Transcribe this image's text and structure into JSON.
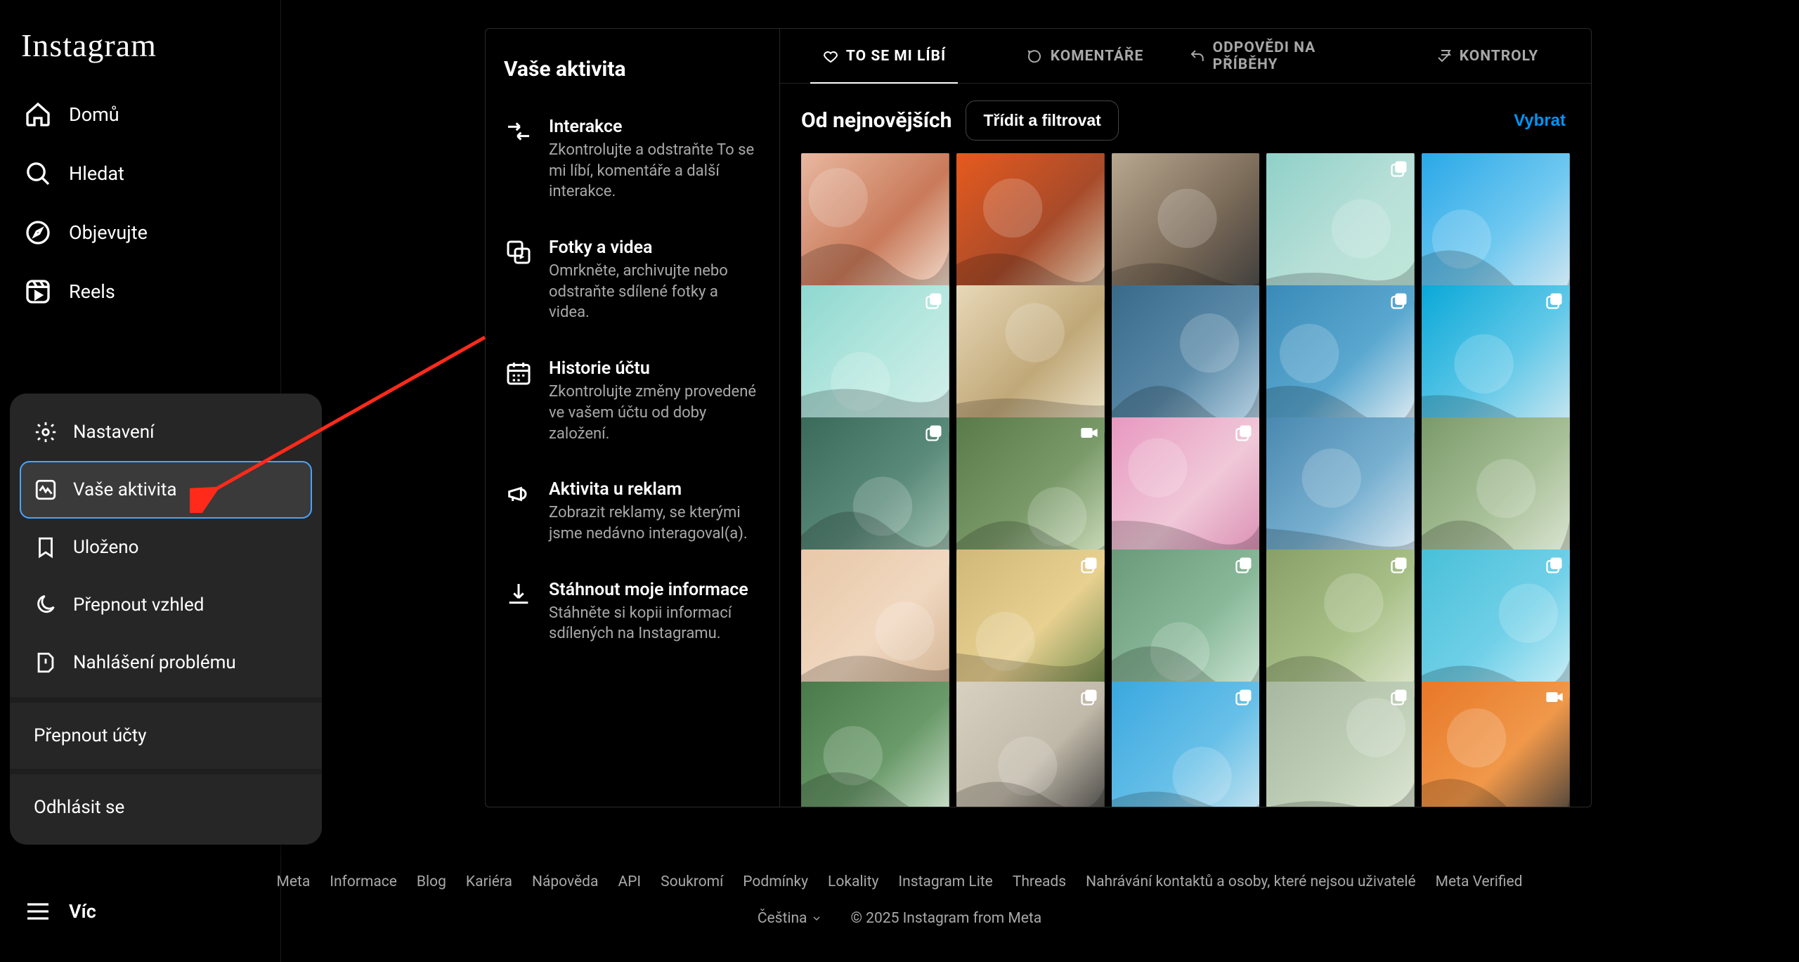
{
  "brand": "Instagram",
  "nav": {
    "home": "Domů",
    "search": "Hledat",
    "explore": "Objevujte",
    "reels": "Reels",
    "more": "Víc"
  },
  "popup": {
    "settings": "Nastavení",
    "activity": "Vaše aktivita",
    "saved": "Uloženo",
    "theme": "Přepnout vzhled",
    "report": "Nahlášení problému",
    "switch": "Přepnout účty",
    "logout": "Odhlásit se"
  },
  "activity_panel": {
    "title": "Vaše aktivita",
    "items": [
      {
        "title": "Interakce",
        "desc": "Zkontrolujte a odstraňte To se mi líbí, komentáře a další interakce."
      },
      {
        "title": "Fotky a videa",
        "desc": "Omrkněte, archivujte nebo odstraňte sdílené fotky a videa."
      },
      {
        "title": "Historie účtu",
        "desc": "Zkontrolujte změny provedené ve vašem účtu od doby založení."
      },
      {
        "title": "Aktivita u reklam",
        "desc": "Zobrazit reklamy, se kterými jsme nedávno interagoval(a)."
      },
      {
        "title": "Stáhnout moje informace",
        "desc": "Stáhněte si kopii informací sdílených na Instagramu."
      }
    ]
  },
  "tabs": {
    "likes": "TO SE MI LÍBÍ",
    "comments": "KOMENTÁŘE",
    "story_replies": "ODPOVĚDI NA PŘÍBĚHY",
    "controls": "KONTROLY"
  },
  "toolbar": {
    "sort_label": "Od nejnovějších",
    "filter_btn": "Třídit a filtrovat",
    "select_btn": "Vybrat"
  },
  "grid": [
    {
      "colors": [
        "#e8b8a0",
        "#c97a5a",
        "#f5e6d8"
      ],
      "badge": "none"
    },
    {
      "colors": [
        "#e65a1e",
        "#a84b2a",
        "#d6c9b0"
      ],
      "badge": "none"
    },
    {
      "colors": [
        "#b8a890",
        "#7a6a58",
        "#3a3a3a"
      ],
      "badge": "none"
    },
    {
      "colors": [
        "#8fd0c8",
        "#b8e0d8",
        "#c0e8d8"
      ],
      "badge": "carousel"
    },
    {
      "colors": [
        "#2aa8e8",
        "#6fc8f0",
        "#d8e8f0"
      ],
      "badge": "none"
    },
    {
      "colors": [
        "#8fd8d0",
        "#b8e8e0",
        "#d8f0ec"
      ],
      "badge": "carousel"
    },
    {
      "colors": [
        "#e8d8b8",
        "#c0a878",
        "#f0e8d0"
      ],
      "badge": "none"
    },
    {
      "colors": [
        "#3a6a8a",
        "#5a8aa8",
        "#c0d8e8"
      ],
      "badge": "none"
    },
    {
      "colors": [
        "#3a8ab8",
        "#5aa8d0",
        "#e8f0f4"
      ],
      "badge": "carousel"
    },
    {
      "colors": [
        "#0aa8d8",
        "#60c8e8",
        "#d0e8f0"
      ],
      "badge": "carousel"
    },
    {
      "colors": [
        "#3a6a5a",
        "#5a8a7a",
        "#a8c8b8"
      ],
      "badge": "carousel"
    },
    {
      "colors": [
        "#5a7a4a",
        "#7a9a6a",
        "#d0e0c0"
      ],
      "badge": "video"
    },
    {
      "colors": [
        "#e898c0",
        "#f0c8d8",
        "#d88ab0"
      ],
      "badge": "carousel"
    },
    {
      "colors": [
        "#4a88b0",
        "#78b0d0",
        "#e0ecf4"
      ],
      "badge": "none"
    },
    {
      "colors": [
        "#7a9a6a",
        "#a8c098",
        "#e0e8d8"
      ],
      "badge": "none"
    },
    {
      "colors": [
        "#e8c8a8",
        "#f0d8c0",
        "#d0b090"
      ],
      "badge": "none"
    },
    {
      "colors": [
        "#d0b878",
        "#e8d090",
        "#6a8a4a"
      ],
      "badge": "carousel"
    },
    {
      "colors": [
        "#6a9a7a",
        "#88b898",
        "#d0e8d8"
      ],
      "badge": "carousel"
    },
    {
      "colors": [
        "#88a068",
        "#a8c088",
        "#e0e8d0"
      ],
      "badge": "carousel"
    },
    {
      "colors": [
        "#48c0d8",
        "#70d0e8",
        "#d0f0f8"
      ],
      "badge": "carousel"
    },
    {
      "colors": [
        "#4a7a4a",
        "#6a9a6a",
        "#d8e8d8"
      ],
      "badge": "none"
    },
    {
      "colors": [
        "#d8d0c0",
        "#c0b8a8",
        "#3a3a3a"
      ],
      "badge": "carousel"
    },
    {
      "colors": [
        "#3aa8e0",
        "#68c0e8",
        "#d0e8f0"
      ],
      "badge": "carousel"
    },
    {
      "colors": [
        "#a8b8a0",
        "#c0d0b8",
        "#e0e8d8"
      ],
      "badge": "carousel"
    },
    {
      "colors": [
        "#e87828",
        "#f0984a",
        "#3a3a3a"
      ],
      "badge": "video"
    }
  ],
  "footer": {
    "links": [
      "Meta",
      "Informace",
      "Blog",
      "Kariéra",
      "Nápověda",
      "API",
      "Soukromí",
      "Podmínky",
      "Lokality",
      "Instagram Lite",
      "Threads",
      "Nahrávání kontaktů a osoby, které nejsou uživatelé",
      "Meta Verified"
    ],
    "language": "Čeština",
    "copyright": "© 2025 Instagram from Meta"
  }
}
